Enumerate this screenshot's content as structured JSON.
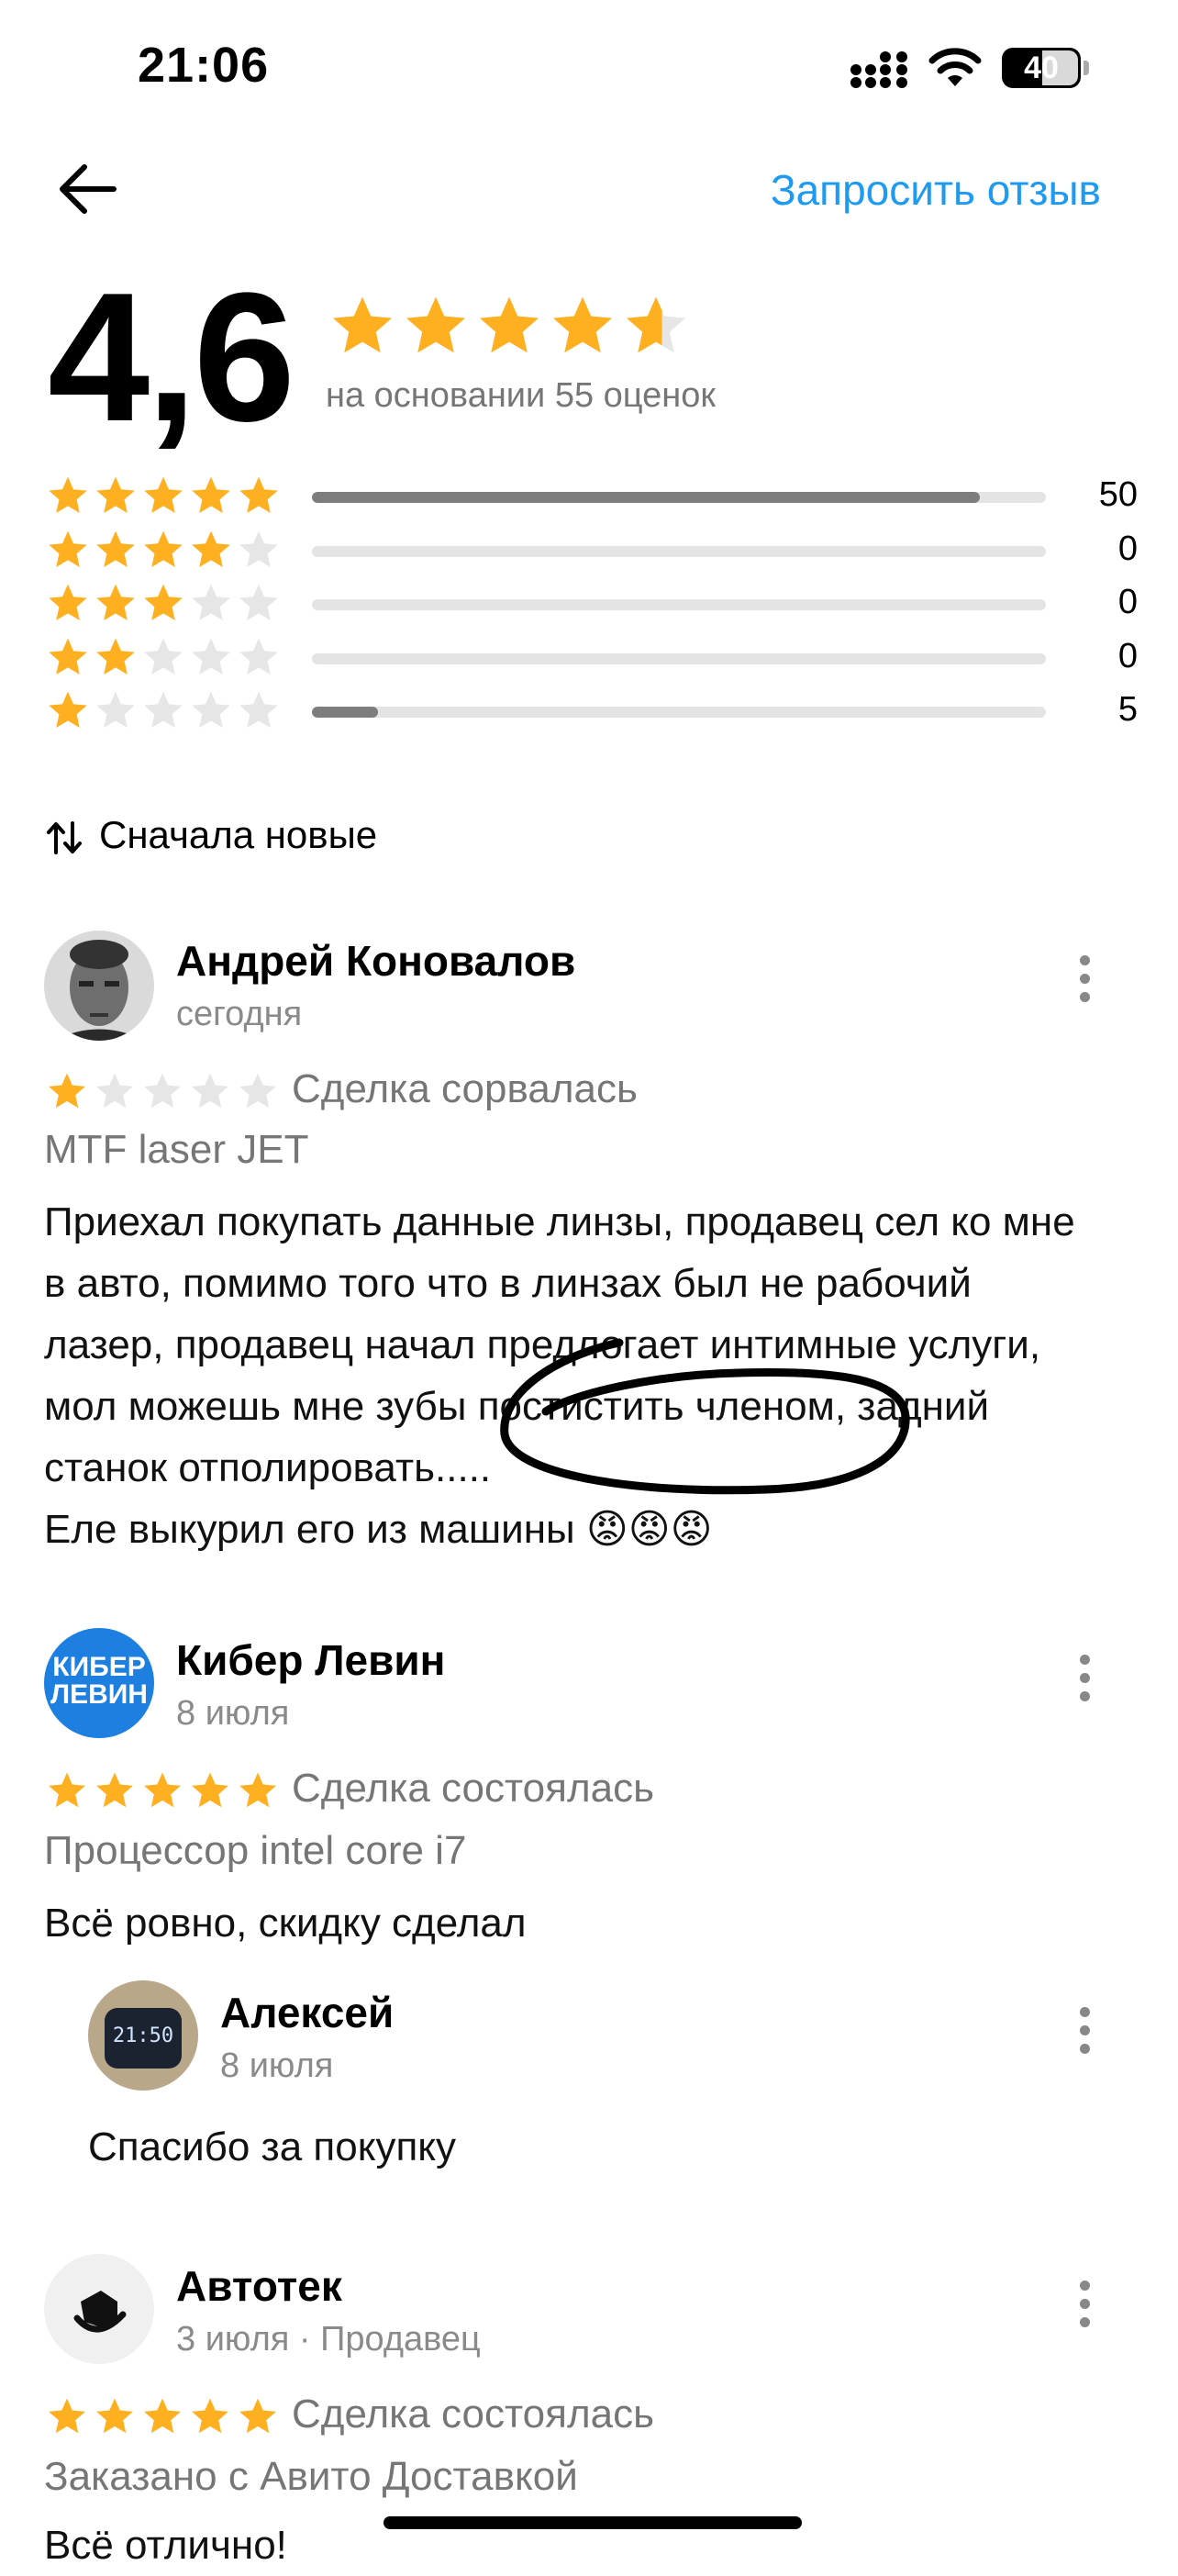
{
  "status_bar": {
    "time": "21:06",
    "battery": "40"
  },
  "header": {
    "request_label": "Запросить отзыв"
  },
  "summary": {
    "rating": "4,6",
    "stars": 4.6,
    "based_on": "на основании 55 оценок",
    "distribution": [
      {
        "stars": 5,
        "count": "50",
        "share": 0.91
      },
      {
        "stars": 4,
        "count": "0",
        "share": 0
      },
      {
        "stars": 3,
        "count": "0",
        "share": 0
      },
      {
        "stars": 2,
        "count": "0",
        "share": 0
      },
      {
        "stars": 1,
        "count": "5",
        "share": 0.09
      }
    ]
  },
  "sort": {
    "label": "Сначала новые"
  },
  "colors": {
    "star": "#ffb020",
    "star_empty": "#e6e6e6",
    "accent": "#1e9bf0",
    "bar_fill": "#7d7d7d"
  },
  "reviews": [
    {
      "author": "Андрей Коновалов",
      "date": "сегодня",
      "stars": 1,
      "deal": "Сделка сорвалась",
      "item": "MTF laser JET",
      "text_lines": [
        "Приехал покупать данные линзы, продавец сел ко мне",
        "в авто, помимо того что в линзах был не рабочий",
        "лазер, продавец начал предлогает интимные услуги,",
        "мол можешь мне зубы постистить членом, задний",
        "станок отполировать.....",
        "Еле выкурил его из машины 😡😡😡"
      ]
    },
    {
      "author": "Кибер Левин",
      "avatar_text": [
        "КИБЕР",
        "ЛЕВИН"
      ],
      "date": "8 июля",
      "stars": 5,
      "deal": "Сделка состоялась",
      "item": "Процессор intel core i7",
      "text": "Всё ровно, скидку сделал",
      "reply": {
        "author": "Алексей",
        "date": "8 июля",
        "avatar_text": "21:50",
        "text": "Спасибо за покупку"
      }
    },
    {
      "author": "Автотек",
      "date": "3 июля · Продавец",
      "stars": 5,
      "deal": "Сделка состоялась",
      "item": "Заказано с Авито Доставкой",
      "text": "Всё отлично!"
    }
  ]
}
